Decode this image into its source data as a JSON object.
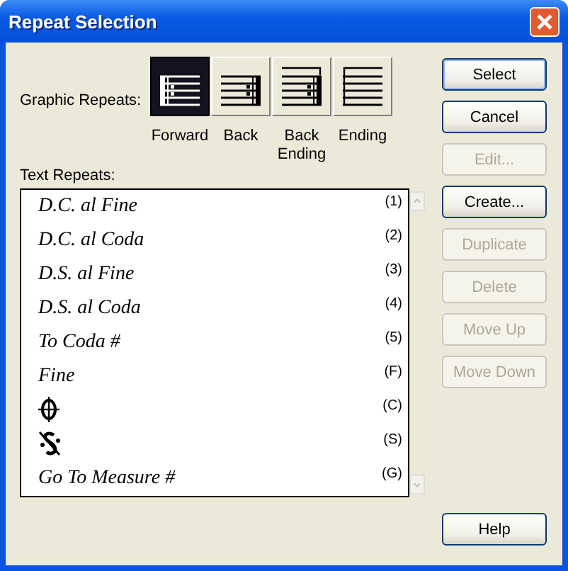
{
  "window": {
    "title": "Repeat Selection"
  },
  "graphic_repeats": {
    "label": "Graphic Repeats:",
    "items": [
      {
        "kind": "forward",
        "label": "Forward",
        "selected": true
      },
      {
        "kind": "back",
        "label": "Back",
        "selected": false
      },
      {
        "kind": "back-ending",
        "label": "Back Ending",
        "selected": false
      },
      {
        "kind": "ending",
        "label": "Ending",
        "selected": false
      }
    ]
  },
  "text_repeats": {
    "label": "Text Repeats:",
    "items": [
      {
        "kind": "text",
        "label": "D.C. al Fine",
        "key": "(1)"
      },
      {
        "kind": "text",
        "label": "D.C. al Coda",
        "key": "(2)"
      },
      {
        "kind": "text",
        "label": "D.S. al Fine",
        "key": "(3)"
      },
      {
        "kind": "text",
        "label": "D.S. al Coda",
        "key": "(4)"
      },
      {
        "kind": "text",
        "label": "To Coda #",
        "key": "(5)"
      },
      {
        "kind": "text",
        "label": "Fine",
        "key": "(F)"
      },
      {
        "kind": "coda",
        "key": "(C)"
      },
      {
        "kind": "segno",
        "key": "(S)"
      },
      {
        "kind": "text",
        "label": "Go To Measure #",
        "key": "(G)"
      }
    ]
  },
  "buttons": [
    {
      "label": "Select",
      "disabled": false,
      "default": true
    },
    {
      "label": "Cancel",
      "disabled": false,
      "default": false
    },
    {
      "label": "Edit...",
      "disabled": true,
      "default": false
    },
    {
      "label": "Create...",
      "disabled": false,
      "default": false
    },
    {
      "label": "Duplicate",
      "disabled": true,
      "default": false
    },
    {
      "label": "Delete",
      "disabled": true,
      "default": false
    },
    {
      "label": "Move Up",
      "disabled": true,
      "default": false
    },
    {
      "label": "Move Down",
      "disabled": true,
      "default": false
    }
  ],
  "help_button": {
    "label": "Help"
  }
}
